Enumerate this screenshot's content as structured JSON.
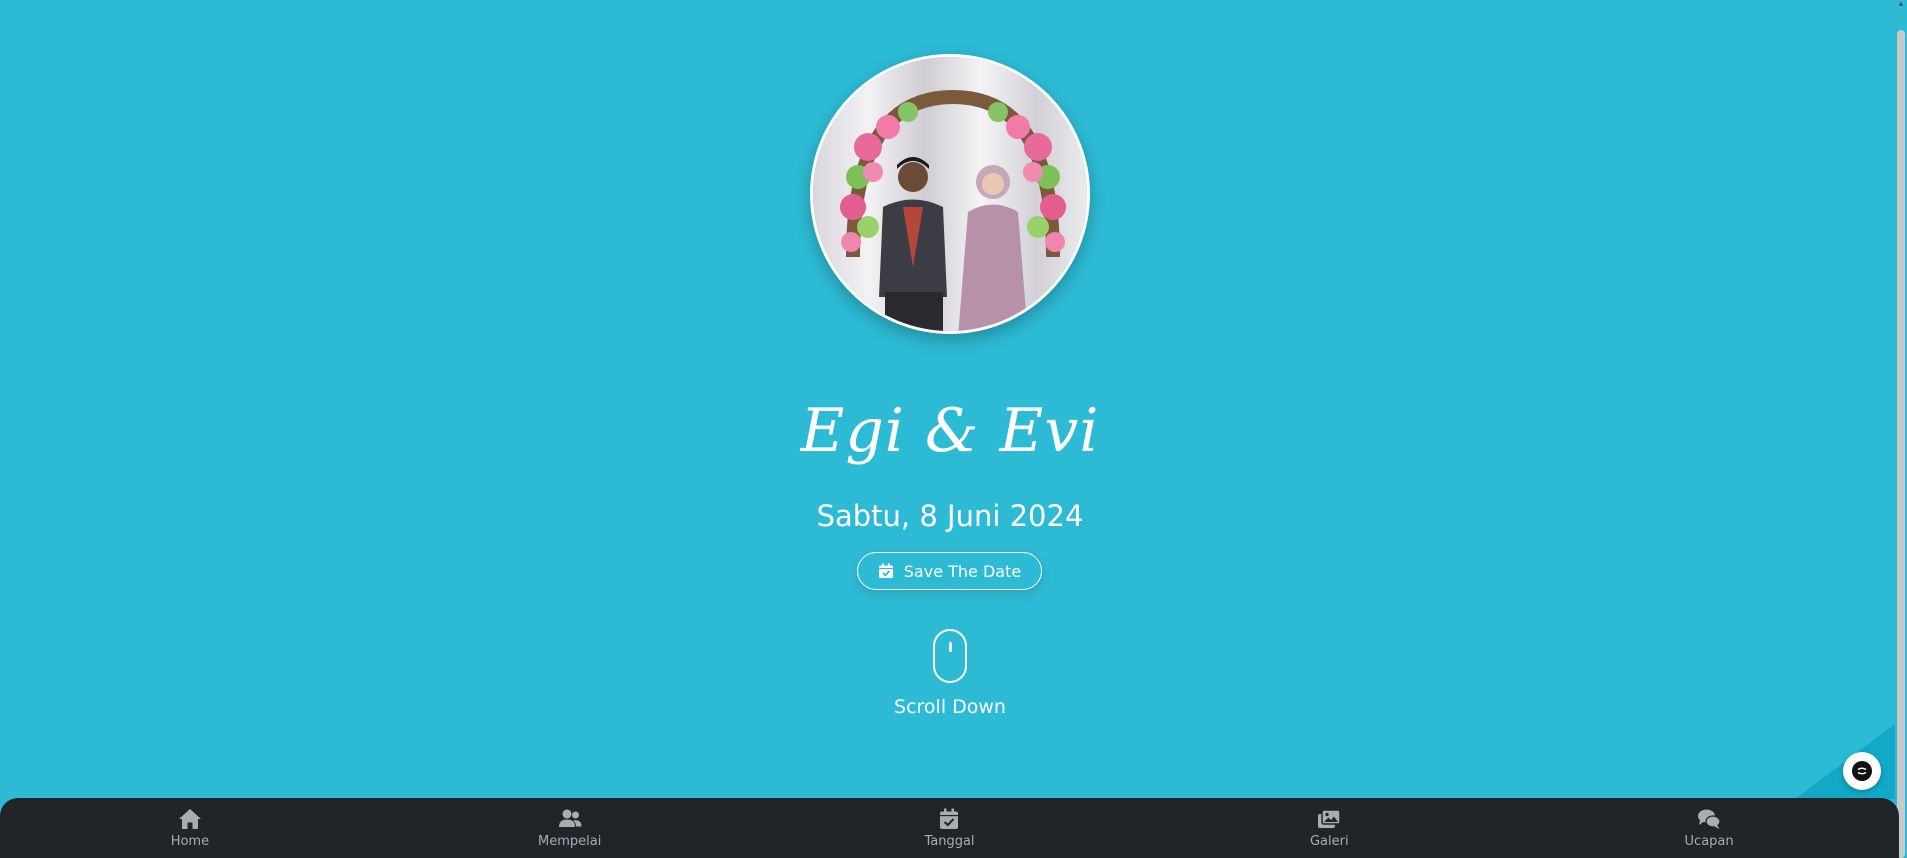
{
  "hero": {
    "couple_names": "Egi & Evi",
    "event_date": "Sabtu, 8 Juni 2024",
    "save_button_label": "Save The Date",
    "scroll_label": "Scroll Down"
  },
  "nav": {
    "items": [
      {
        "label": "Home",
        "icon": "home-icon"
      },
      {
        "label": "Mempelai",
        "icon": "users-icon"
      },
      {
        "label": "Tanggal",
        "icon": "calendar-check-icon"
      },
      {
        "label": "Galeri",
        "icon": "images-icon"
      },
      {
        "label": "Ucapan",
        "icon": "comments-icon"
      }
    ]
  },
  "colors": {
    "background": "#2dbad4",
    "nav_background": "#212529",
    "nav_label": "#a9adb2",
    "text": "#ffffff"
  },
  "icons": {
    "music": "music-disc-icon",
    "mouse": "mouse-scroll-icon"
  }
}
